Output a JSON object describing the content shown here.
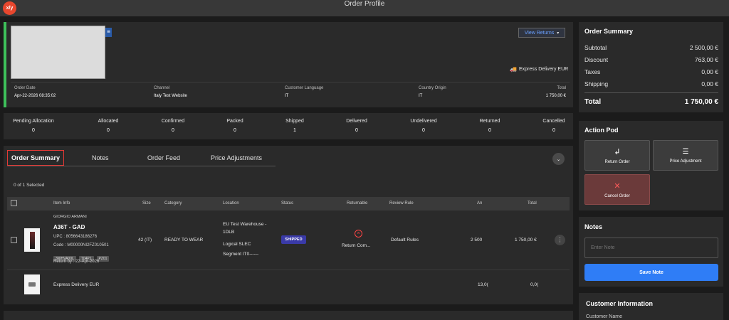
{
  "app": {
    "logo_text": "x/y",
    "title": "Order Profile"
  },
  "header": {
    "view_returns": "View Returns",
    "delivery": "Express Delivery EUR",
    "fields": [
      {
        "label": "Order Date",
        "value": "Apr-22-2026 08:35:02"
      },
      {
        "label": "Channel",
        "value": "Italy Test Website"
      },
      {
        "label": "Customer Language",
        "value": "IT"
      },
      {
        "label": "Country Origin",
        "value": "IT"
      },
      {
        "label": "Total",
        "value": "1 750,00 €"
      }
    ]
  },
  "statuses": [
    {
      "label": "Pending Allocation",
      "count": "0"
    },
    {
      "label": "Allocated",
      "count": "0"
    },
    {
      "label": "Confirmed",
      "count": "0"
    },
    {
      "label": "Packed",
      "count": "0"
    },
    {
      "label": "Shipped",
      "count": "1"
    },
    {
      "label": "Delivered",
      "count": "0"
    },
    {
      "label": "Undelivered",
      "count": "0"
    },
    {
      "label": "Returned",
      "count": "0"
    },
    {
      "label": "Cancelled",
      "count": "0"
    }
  ],
  "tabs": [
    "Order Summary",
    "Notes",
    "Order Feed",
    "Price Adjustments"
  ],
  "items_table": {
    "selected_text": "0 of 1 Selected",
    "headers": [
      "Item Info",
      "Size",
      "Category",
      "Location",
      "Status",
      "Returnable",
      "Review Rule",
      "An",
      "Total"
    ],
    "row": {
      "brand": "GIORGIO ARMANI",
      "name": "A36T - GAD",
      "upc": "UPC : 8056643186276",
      "code": "Code : M00000NI2FZ010501",
      "badges": [
        "3WHVA00L",
        "T04P1",
        "PZ01"
      ],
      "return_by": "Return by : 22-Apr-2026",
      "size": "42 (IT)",
      "category": "READY TO WEAR",
      "location_line1": "EU Test Warehouse -",
      "location_line2": "1DLB",
      "location_logical": "Logical SLEC",
      "location_segment": "Segment IT0------",
      "status": "SHIPPED",
      "returnable": "Return Com...",
      "review_rule": "Default Rules",
      "amount": "2 500",
      "total": "1 750,00 €"
    },
    "shipping_row": {
      "name": "Express Delivery EUR",
      "amount": "13,0(",
      "total": "0,0("
    }
  },
  "order_summary": {
    "title": "Order Summary",
    "rows": [
      {
        "label": "Subtotal",
        "value": "2 500,00 €"
      },
      {
        "label": "Discount",
        "value": "763,00 €"
      },
      {
        "label": "Taxes",
        "value": "0,00 €"
      },
      {
        "label": "Shipping",
        "value": "0,00 €"
      }
    ],
    "total_label": "Total",
    "total_value": "1 750,00 €"
  },
  "action_pod": {
    "title": "Action Pod",
    "return_order": "Return Order",
    "price_adjustment": "Price Adjustment",
    "cancel_order": "Cancel Order"
  },
  "notes": {
    "title": "Notes",
    "placeholder": "Enter Note",
    "save": "Save Note"
  },
  "customer_info": {
    "title": "Customer Information",
    "first_label": "Customer Name"
  },
  "colors": {
    "accent": "#2f7df6",
    "status_shipped": "#3a3aa8",
    "cancel": "#6b3a3a",
    "green_bar": "#3ec05a"
  }
}
